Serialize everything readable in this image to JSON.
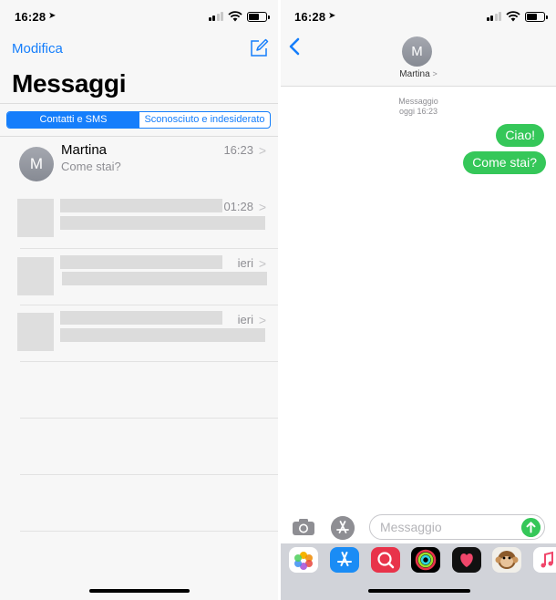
{
  "left_screen": {
    "status": {
      "time": "16:28"
    },
    "header": {
      "edit_label": "Modifica",
      "title": "Messaggi",
      "compose_icon": "compose-icon"
    },
    "segments": [
      {
        "label": "Contatti e SMS",
        "selected": true
      },
      {
        "label": "Sconosciuto e indesiderato",
        "selected": false
      }
    ],
    "conversations": [
      {
        "avatar_initial": "M",
        "name": "Martina",
        "preview": "Come stai?",
        "time": "16:23"
      },
      {
        "time": "01:28",
        "redacted": true
      },
      {
        "time": "ieri",
        "redacted": true
      },
      {
        "time": "ieri",
        "redacted": true
      }
    ]
  },
  "right_screen": {
    "status": {
      "time": "16:28"
    },
    "contact": {
      "avatar_initial": "M",
      "name": "Martina"
    },
    "thread_header": {
      "line1": "Messaggio",
      "line2": "oggi 16:23"
    },
    "messages": [
      {
        "text": "Ciao!",
        "sender": "me"
      },
      {
        "text": "Come stai?",
        "sender": "me"
      }
    ],
    "composer": {
      "placeholder": "Messaggio",
      "value": ""
    },
    "app_drawer": [
      "photos-app-icon",
      "app-store-icon",
      "web-images-search-icon",
      "activity-rings-icon",
      "digital-touch-heart-icon",
      "animoji-monkey-icon",
      "music-app-icon"
    ]
  },
  "colors": {
    "ios_blue": "#157efb",
    "imessage_green": "#35c759",
    "gray_text": "#8e8e93"
  }
}
